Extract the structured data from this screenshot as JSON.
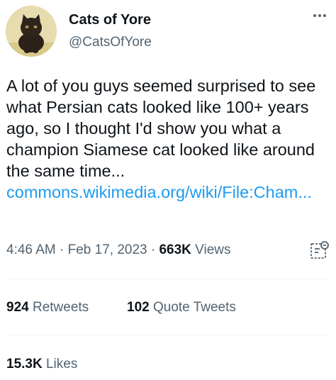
{
  "user": {
    "display_name": "Cats of Yore",
    "handle": "@CatsOfYore"
  },
  "tweet": {
    "text": "A lot of you guys seemed surprised to see what Persian cats looked like 100+ years ago, so I thought I'd show you what a champion Siamese cat looked like around the same time...",
    "link_text": "commons.wikimedia.org/wiki/File:Cham..."
  },
  "meta": {
    "time": "4:46 AM",
    "sep1": " · ",
    "date": "Feb 17, 2023",
    "sep2": " · ",
    "views_count": "663K",
    "views_label": " Views"
  },
  "stats": {
    "retweets_count": "924",
    "retweets_label": " Retweets",
    "quote_count": "102",
    "quote_label": " Quote Tweets",
    "likes_count": "15.3K",
    "likes_label": " Likes"
  },
  "icons": {
    "more": "more-options-icon",
    "analytics": "analytics-icon",
    "avatar": "cat-avatar"
  },
  "colors": {
    "link": "#1d9bf0",
    "secondary_text": "#536471",
    "primary_text": "#0f1419",
    "divider": "#eff3f4"
  }
}
